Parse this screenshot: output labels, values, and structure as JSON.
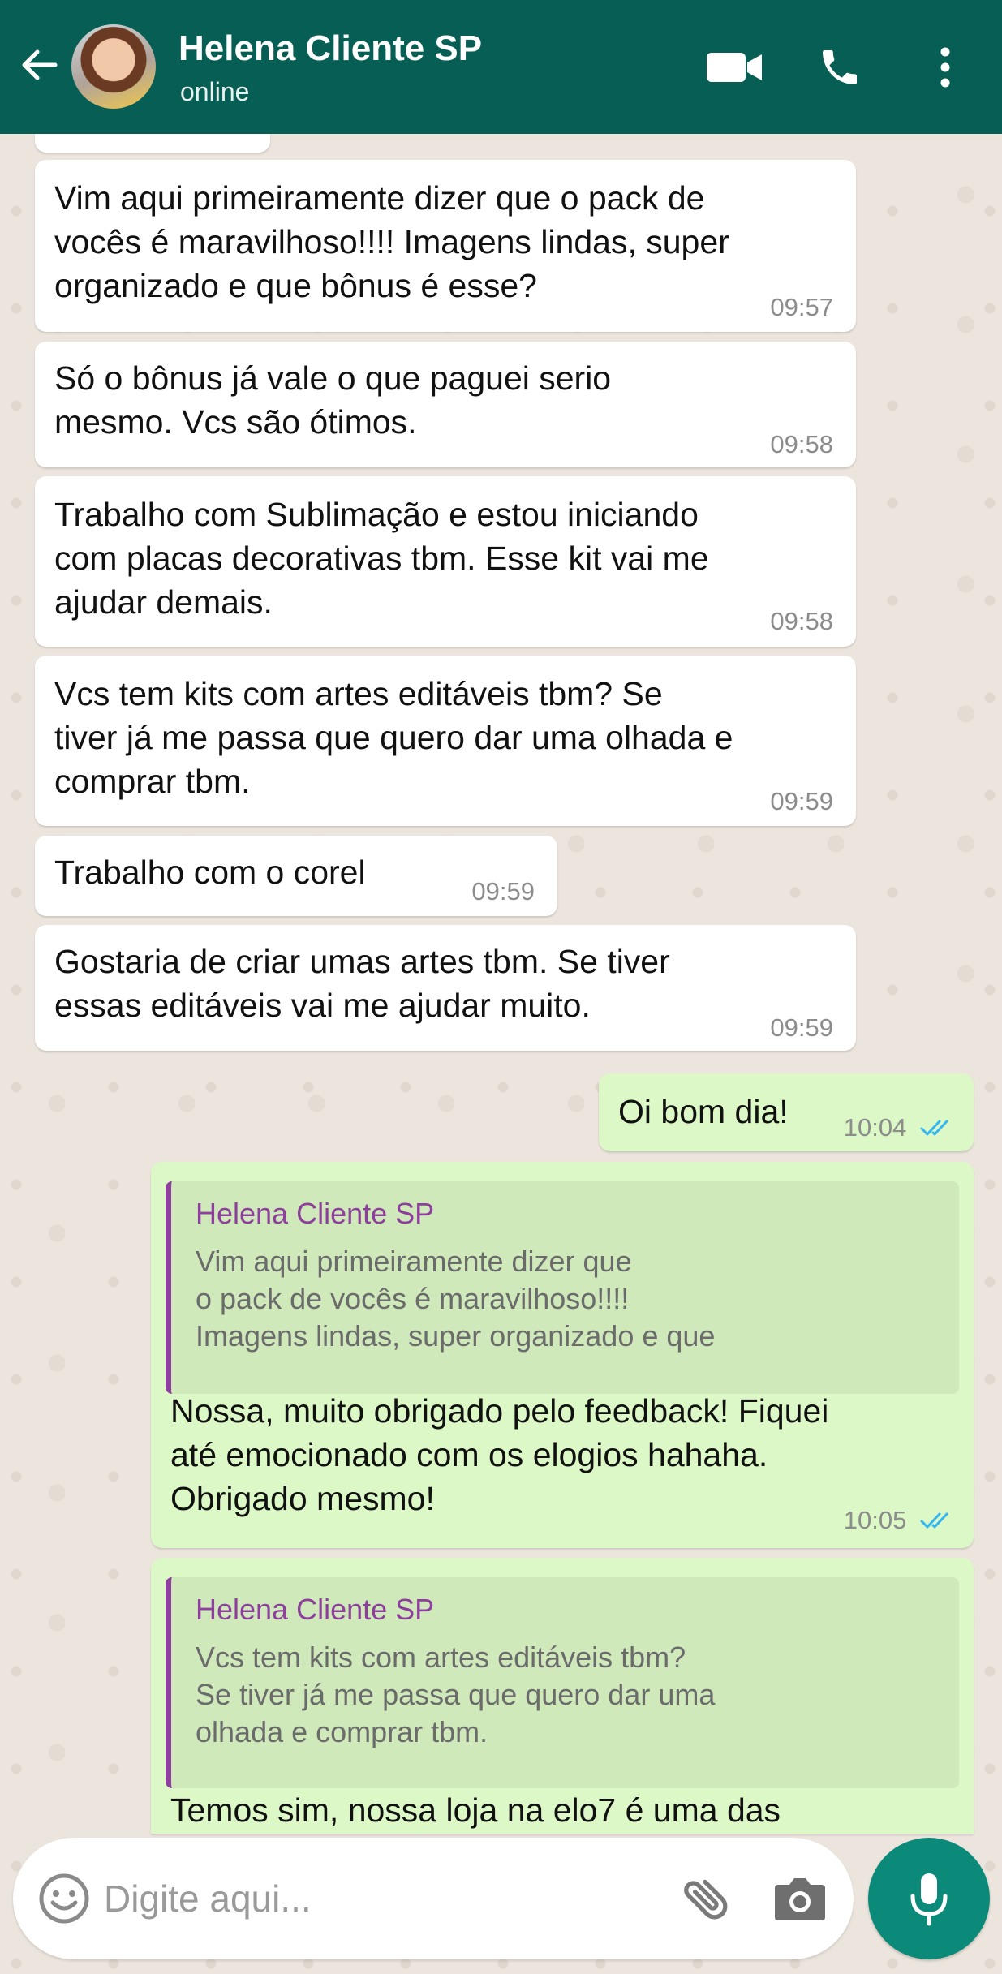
{
  "colors": {
    "header": "#075e54",
    "incoming": "#ffffff",
    "outgoing": "#dcf8c6",
    "quote_author": "#8e3e9c",
    "read_ticks": "#34b7f1",
    "mic": "#0b8a7a"
  },
  "header": {
    "contact_name": "Helena Cliente SP",
    "status": "online",
    "icons": [
      "back-arrow-icon",
      "video-call-icon",
      "voice-call-icon",
      "more-options-icon"
    ]
  },
  "messages": [
    {
      "direction": "in",
      "text": "Vim aqui primeiramente dizer que o pack de\nvocês é maravilhoso!!!! Imagens lindas, super\norganizado e que bônus é esse?",
      "time": "09:57"
    },
    {
      "direction": "in",
      "text": "Só o bônus já vale o que paguei serio\nmesmo. Vcs são ótimos.",
      "time": "09:58"
    },
    {
      "direction": "in",
      "text": "Trabalho com Sublimação e estou iniciando\ncom placas decorativas tbm. Esse kit vai me\najudar demais.",
      "time": "09:58"
    },
    {
      "direction": "in",
      "text": "Vcs tem kits com artes editáveis tbm? Se\ntiver já me passa que quero dar uma olhada e\ncomprar tbm.",
      "time": "09:59"
    },
    {
      "direction": "in",
      "text": "Trabalho com o corel",
      "time": "09:59"
    },
    {
      "direction": "in",
      "text": "Gostaria de criar umas artes tbm. Se tiver\nessas editáveis vai me ajudar muito.",
      "time": "09:59"
    },
    {
      "direction": "out",
      "text": "Oi bom dia!",
      "time": "10:04",
      "status": "read"
    },
    {
      "direction": "out",
      "quote_author": "Helena Cliente SP",
      "quote_text": "Vim aqui primeiramente dizer que\no pack de vocês é maravilhoso!!!!\nImagens lindas, super organizado e que",
      "text": "Nossa, muito obrigado pelo feedback! Fiquei\naté emocionado com os elogios hahaha.\nObrigado mesmo!",
      "time": "10:05",
      "status": "read"
    },
    {
      "direction": "out",
      "quote_author": "Helena Cliente SP",
      "quote_text": "Vcs tem kits com artes editáveis tbm?\nSe tiver já me passa que quero dar uma\nolhada e comprar tbm.",
      "text": "Temos sim, nossa loja na elo7 é uma das"
    }
  ],
  "composer": {
    "placeholder": "Digite aqui...",
    "icons": [
      "emoji-icon",
      "attach-icon",
      "camera-icon",
      "microphone-icon"
    ]
  }
}
